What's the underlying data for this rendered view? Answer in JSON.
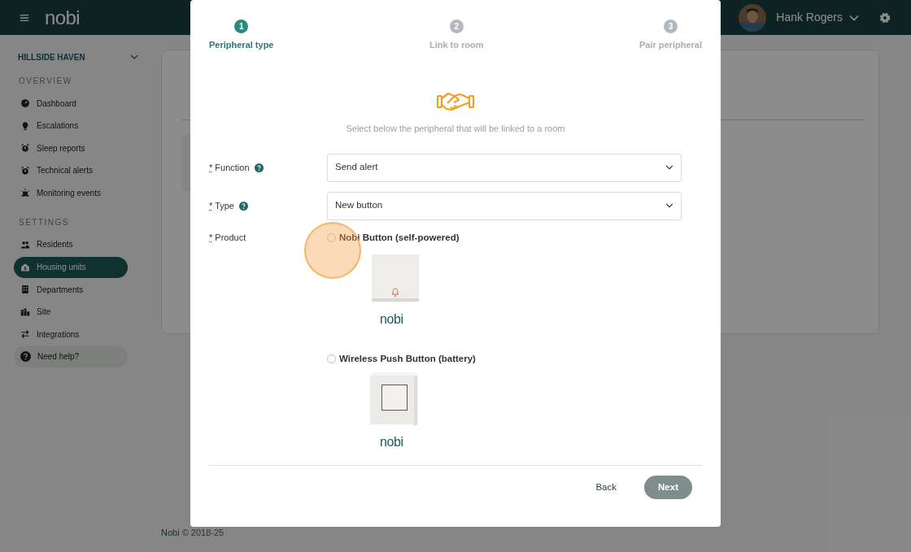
{
  "header": {
    "logo": "nobi",
    "user": {
      "name": "Hank Rogers"
    }
  },
  "sidebar": {
    "site": "HILLSIDE HAVEN",
    "sections": [
      {
        "title": "OVERVIEW",
        "items": [
          {
            "label": "Dashboard",
            "selected": false
          },
          {
            "label": "Escalations",
            "selected": false
          },
          {
            "label": "Sleep reports",
            "selected": false
          },
          {
            "label": "Technical alerts",
            "selected": false
          },
          {
            "label": "Monitoring events",
            "selected": false
          }
        ]
      },
      {
        "title": "SETTINGS",
        "items": [
          {
            "label": "Residents",
            "selected": false
          },
          {
            "label": "Housing units",
            "selected": true
          },
          {
            "label": "Departments",
            "selected": false
          },
          {
            "label": "Site",
            "selected": false
          },
          {
            "label": "Integrations",
            "selected": false
          }
        ]
      }
    ],
    "help": "Need help?"
  },
  "footer": {
    "brand": "Nobi",
    "text": "© 2018-25"
  },
  "modal": {
    "steps": [
      {
        "number": "1",
        "label": "Peripheral type",
        "selected": true
      },
      {
        "number": "2",
        "label": "Link to room",
        "selected": false
      },
      {
        "number": "3",
        "label": "Pair peripheral",
        "selected": false
      }
    ],
    "intro": "Select below the peripheral that will be linked to a room",
    "fields": [
      {
        "label": "Function",
        "required_mark": "*",
        "help": true,
        "value": "Send alert"
      },
      {
        "label": "Type",
        "required_mark": "*",
        "help": true,
        "value": "New button"
      }
    ],
    "product": {
      "label": "Product",
      "required_mark": "*",
      "options": [
        {
          "label": "Nobi Button (self-powered)",
          "selected": false,
          "kind": "flat",
          "brand": "nobi"
        },
        {
          "label": "Wireless Push Button (battery)",
          "selected": false,
          "kind": "box",
          "brand": "nobi"
        }
      ]
    },
    "buttons": {
      "back": "Back",
      "next": {
        "label": "Next",
        "disabled": true
      }
    }
  },
  "click_highlight": true
}
